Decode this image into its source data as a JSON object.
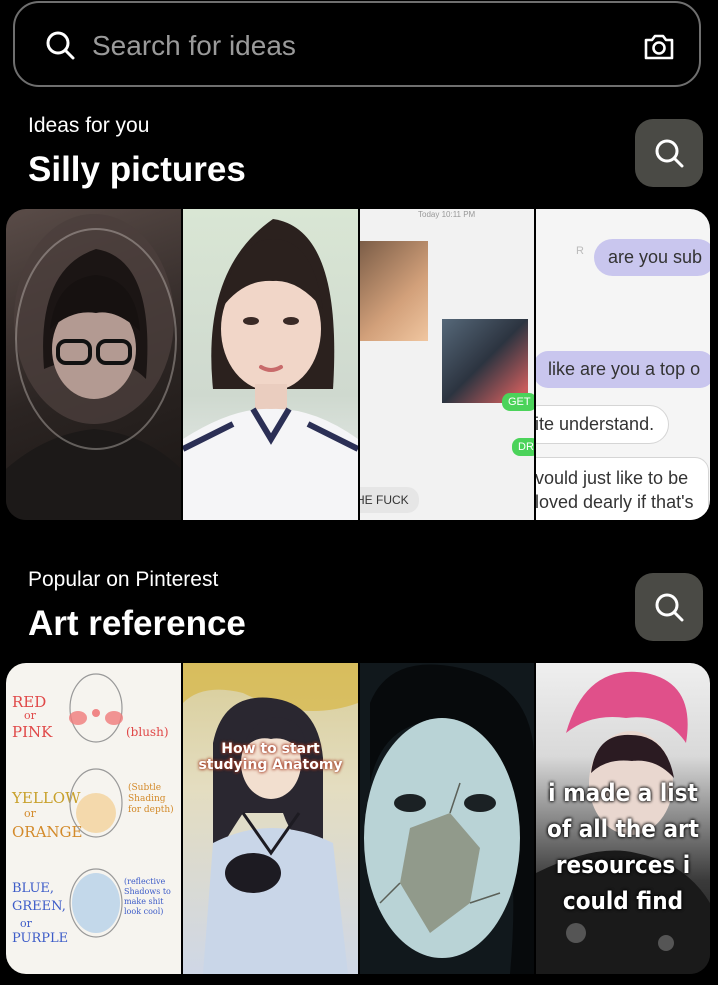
{
  "search": {
    "placeholder": "Search for ideas"
  },
  "sections": [
    {
      "subtitle": "Ideas for you",
      "title": "Silly pictures",
      "tiles": [
        {
          "kind": "photo"
        },
        {
          "kind": "photo"
        },
        {
          "kind": "chat",
          "timestamp": "Today 10:11 PM",
          "texts": [
            "GET",
            "DR",
            "HE FUCK"
          ]
        },
        {
          "kind": "chat",
          "texts": [
            "are you sub",
            "like are you a top o",
            "ite understand.",
            "vould just like to be",
            "loved dearly if that's"
          ]
        }
      ]
    },
    {
      "subtitle": "Popular on Pinterest",
      "title": "Art reference",
      "tiles": [
        {
          "kind": "art",
          "labels": [
            "RED",
            "or",
            "PINK",
            "(blush)",
            "YELLOW",
            "or",
            "ORANGE",
            "(Subtle Shading for depth)",
            "BLUE,",
            "GREEN,",
            "or",
            "PURPLE",
            "(reflective Shadows to make shit look cool)"
          ]
        },
        {
          "kind": "art",
          "overlay": "How to start studying Anatomy"
        },
        {
          "kind": "photo"
        },
        {
          "kind": "photo",
          "overlay": "i made a list of all the art resources i could find"
        }
      ]
    }
  ]
}
